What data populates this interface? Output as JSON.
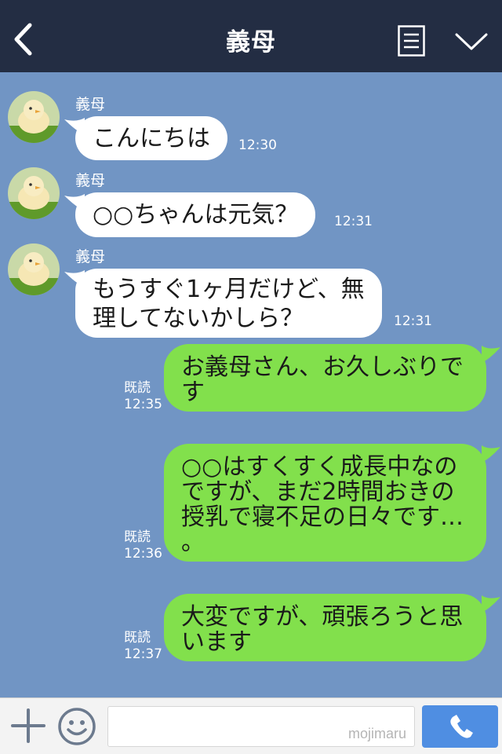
{
  "header": {
    "title": "義母",
    "back_icon": "chevron-left-icon",
    "menu_icon": "note-icon",
    "collapse_icon": "chevron-down-icon",
    "background": "#232d43"
  },
  "chat": {
    "background": "#7195c4",
    "incoming_bubble_color": "#ffffff",
    "outgoing_bubble_color": "#82e04c",
    "messages": [
      {
        "direction": "in",
        "sender": "義母",
        "text": "こんにちは",
        "time": "12:30"
      },
      {
        "direction": "in",
        "sender": "義母",
        "text": "○○ちゃんは元気？",
        "time": "12:31"
      },
      {
        "direction": "in",
        "sender": "義母",
        "lines": [
          "もうすぐ1ヶ月だけど、無",
          "理してないかしら？"
        ],
        "time": "12:31"
      },
      {
        "direction": "out",
        "read": "既読",
        "time": "12:35",
        "lines": [
          "お義母さん、お久しぶりで",
          "す"
        ]
      },
      {
        "direction": "out",
        "read": "既読",
        "time": "12:36",
        "lines": [
          "○○はすくすく成長中なの",
          "ですが、まだ2時間おきの",
          "授乳で寝不足の日々です…",
          "。"
        ]
      },
      {
        "direction": "out",
        "read": "既読",
        "time": "12:37",
        "lines": [
          "大変ですが、頑張ろうと思",
          "います"
        ]
      }
    ]
  },
  "input_bar": {
    "plus_icon": "plus-icon",
    "emoji_icon": "smiley-icon",
    "watermark": "mojimaru",
    "call_icon": "phone-icon",
    "call_color": "#4f8ee2"
  }
}
